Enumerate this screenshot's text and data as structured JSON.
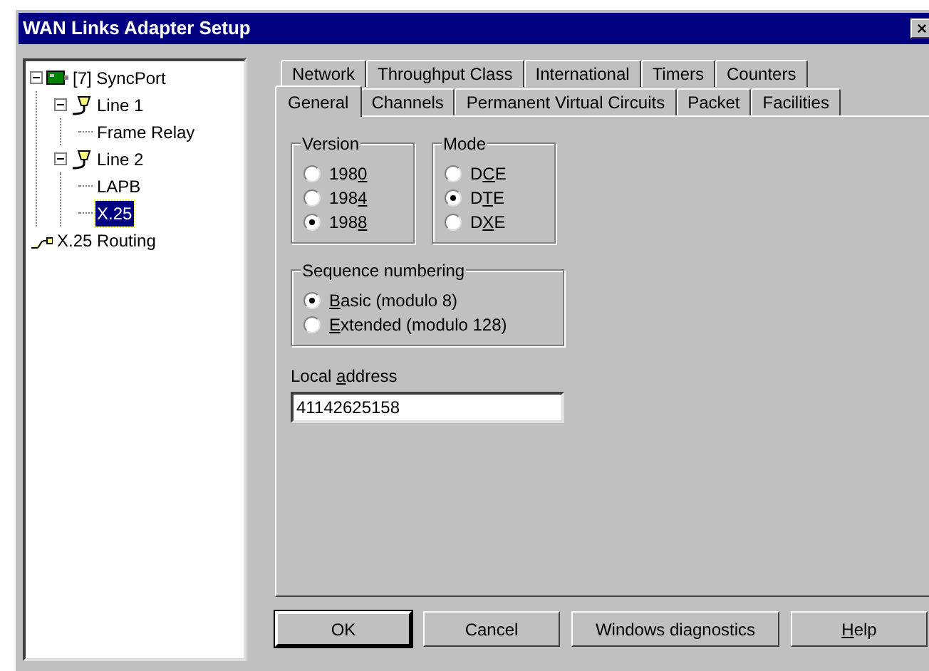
{
  "window": {
    "title": "WAN Links Adapter Setup",
    "close_glyph": "×"
  },
  "tree": [
    {
      "label": "[7] SyncPort",
      "kind": "port",
      "selected": false,
      "expanded": true,
      "children": [
        {
          "label": "Line 1",
          "kind": "line",
          "selected": false,
          "expanded": true,
          "children": [
            {
              "label": "Frame Relay",
              "kind": "leaf",
              "selected": false
            }
          ]
        },
        {
          "label": "Line 2",
          "kind": "line",
          "selected": false,
          "expanded": true,
          "children": [
            {
              "label": "LAPB",
              "kind": "leaf",
              "selected": false
            },
            {
              "label": "X.25",
              "kind": "leaf",
              "selected": true
            }
          ]
        }
      ]
    },
    {
      "label": "X.25 Routing",
      "kind": "routing",
      "selected": false
    }
  ],
  "tab_rows": [
    [
      {
        "label": "Network",
        "selected": false
      },
      {
        "label": "Throughput Class",
        "selected": false
      },
      {
        "label": "International",
        "selected": false
      },
      {
        "label": "Timers",
        "selected": false
      },
      {
        "label": "Counters",
        "selected": false
      }
    ],
    [
      {
        "label": "General",
        "selected": true
      },
      {
        "label": "Channels",
        "selected": false
      },
      {
        "label": "Permanent Virtual Circuits",
        "selected": false
      },
      {
        "label": "Packet",
        "selected": false
      },
      {
        "label": "Facilities",
        "selected": false
      }
    ]
  ],
  "version": {
    "title": "Version",
    "options": [
      {
        "before": "198",
        "key": "0",
        "selected": false
      },
      {
        "before": "198",
        "key": "4",
        "selected": false
      },
      {
        "before": "198",
        "key": "8",
        "selected": true
      }
    ]
  },
  "mode": {
    "title": "Mode",
    "options": [
      {
        "before": "D",
        "key": "C",
        "after": "E",
        "selected": false
      },
      {
        "before": "D",
        "key": "T",
        "after": "E",
        "selected": true
      },
      {
        "before": "D",
        "key": "X",
        "after": "E",
        "selected": false
      }
    ]
  },
  "sequence_numbering": {
    "title": "Sequence numbering",
    "options": [
      {
        "key": "B",
        "after": "asic (modulo 8)",
        "selected": true
      },
      {
        "key": "E",
        "after": "xtended (modulo 128)",
        "selected": false
      }
    ]
  },
  "local_address": {
    "label": {
      "before": "Local ",
      "key": "a",
      "after": "ddress"
    },
    "value": "41142625158"
  },
  "buttons": [
    {
      "label": {
        "before": "OK"
      },
      "default": true
    },
    {
      "label": {
        "before": "Cancel"
      },
      "default": false
    },
    {
      "label": {
        "before": "Windows diagnostics"
      },
      "default": false
    },
    {
      "label": {
        "key": "H",
        "after": "elp"
      },
      "default": false
    }
  ]
}
